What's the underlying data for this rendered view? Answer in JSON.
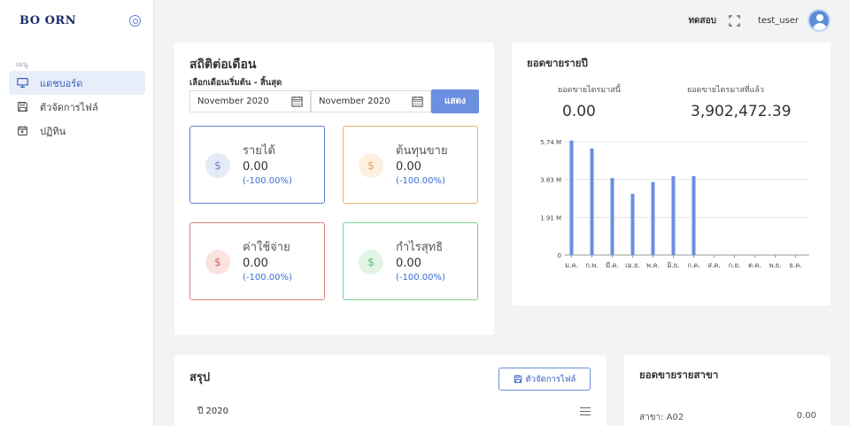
{
  "sidebar": {
    "logo": "BO ORN",
    "menu_heading": "เมนู",
    "items": [
      {
        "label": "แดชบอร์ด",
        "icon": "monitor-icon",
        "active": true
      },
      {
        "label": "ตัวจัดการไฟล์",
        "icon": "save-icon",
        "active": false
      },
      {
        "label": "ปฏิทิน",
        "icon": "calendar-icon",
        "active": false
      }
    ]
  },
  "header": {
    "test_label": "ทดสอบ",
    "fullscreen_icon": "fullscreen-icon",
    "username": "test_user",
    "avatar_icon": "user-avatar-icon"
  },
  "monthly": {
    "title": "สถิติต่อเดือน",
    "range_label": "เลือกเดือนเริ่มต้น - สิ้นสุด",
    "start_month": "November 2020",
    "end_month": "November 2020",
    "show_button": "แสดง",
    "stats": [
      {
        "label": "รายได้",
        "value": "0.00",
        "pct": "(-100.00%)",
        "symbol": "$",
        "border": "#5a7fd6",
        "circle_bg": "#e4eaf7",
        "circle_fg": "#6a8bd6"
      },
      {
        "label": "ต้นทุนขาย",
        "value": "0.00",
        "pct": "(-100.00%)",
        "symbol": "$",
        "border": "#e8b07a",
        "circle_bg": "#fdf0e1",
        "circle_fg": "#e5a35a"
      },
      {
        "label": "ค่าใช้จ่าย",
        "value": "0.00",
        "pct": "(-100.00%)",
        "symbol": "$",
        "border": "#e08079",
        "circle_bg": "#fbe3e2",
        "circle_fg": "#e0635b"
      },
      {
        "label": "กำไรสุทธิ",
        "value": "0.00",
        "pct": "(-100.00%)",
        "symbol": "$",
        "border": "#7fcc94",
        "circle_bg": "#e1f4e6",
        "circle_fg": "#5bbd78"
      }
    ]
  },
  "yearly": {
    "title": "ยอดขายรายปี",
    "this_q_label": "ยอดขายไตรมาสนี้",
    "this_q_value": "0.00",
    "last_q_label": "ยอดขายไตรมาสที่แล้ว",
    "last_q_value": "3,902,472.39"
  },
  "chart_data": {
    "type": "bar",
    "categories": [
      "ม.ค.",
      "ก.พ.",
      "มี.ค.",
      "เม.ย.",
      "พ.ค.",
      "มิ.ย.",
      "ก.ค.",
      "ส.ค.",
      "ก.ย.",
      "ต.ค.",
      "พ.ย.",
      "ธ.ค."
    ],
    "values": [
      5.8,
      5.4,
      3.9,
      3.1,
      3.7,
      4.0,
      4.0,
      0,
      0,
      0,
      0,
      0
    ],
    "ticks": [
      "0",
      "1.91 M",
      "3.83 M",
      "5.74 M"
    ],
    "tick_values": [
      0,
      1.91,
      3.83,
      5.74
    ],
    "ylim": [
      0,
      5.74
    ],
    "unit": "M",
    "grid": true,
    "bar_color": "#6b8fe0"
  },
  "summary": {
    "title": "สรุป",
    "file_button": "ตัวจัดการไฟล์",
    "year_row": "ปี 2020"
  },
  "branches": {
    "title": "ยอดขายรายสาขา",
    "rows": [
      {
        "branch": "สาขา: A02",
        "value": "0.00"
      }
    ]
  }
}
